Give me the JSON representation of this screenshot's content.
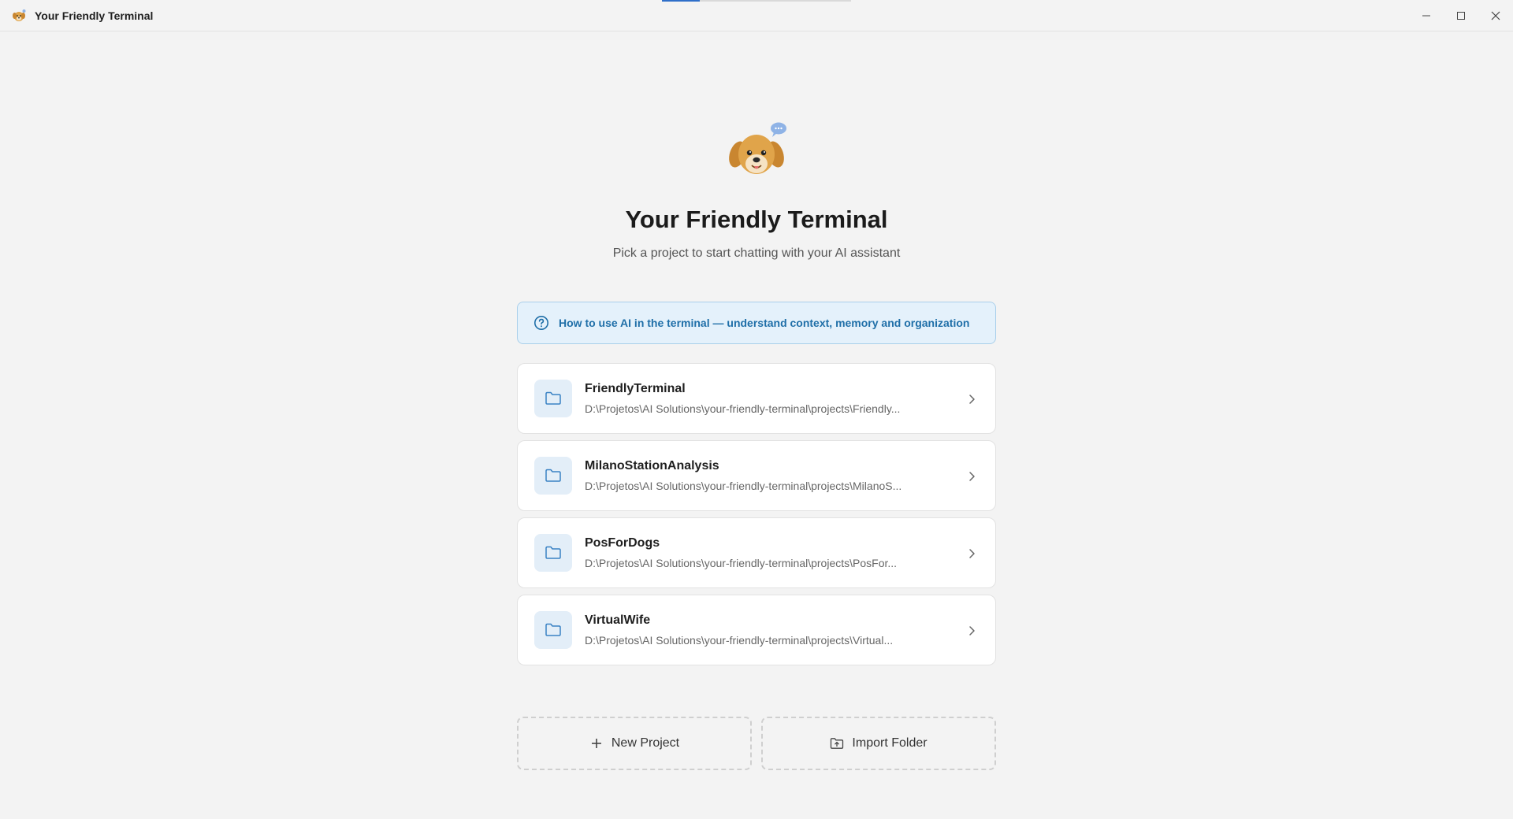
{
  "window": {
    "title": "Your Friendly Terminal",
    "icon": "dog-icon",
    "loading_progress": 0.2,
    "controls": {
      "minimize": "minimize-icon",
      "maximize": "maximize-icon",
      "close": "close-icon"
    }
  },
  "hero": {
    "logo": "dog-with-chat-bubble-icon",
    "title": "Your Friendly Terminal",
    "subtitle": "Pick a project to start chatting with your AI assistant"
  },
  "help_banner": {
    "icon": "question-circle-icon",
    "text": "How to use AI in the terminal — understand context, memory and organization"
  },
  "projects": [
    {
      "name": "FriendlyTerminal",
      "path": "D:\\Projetos\\AI Solutions\\your-friendly-terminal\\projects\\Friendly..."
    },
    {
      "name": "MilanoStationAnalysis",
      "path": "D:\\Projetos\\AI Solutions\\your-friendly-terminal\\projects\\MilanoS..."
    },
    {
      "name": "PosForDogs",
      "path": "D:\\Projetos\\AI Solutions\\your-friendly-terminal\\projects\\PosFor..."
    },
    {
      "name": "VirtualWife",
      "path": "D:\\Projetos\\AI Solutions\\your-friendly-terminal\\projects\\Virtual..."
    }
  ],
  "actions": {
    "new_project": {
      "label": "New Project",
      "icon": "plus-icon"
    },
    "import_folder": {
      "label": "Import Folder",
      "icon": "folder-import-icon"
    }
  },
  "colors": {
    "background": "#f3f3f3",
    "accent": "#1f6fa8",
    "banner_bg": "#e4f1fb",
    "folder_tile": "#e3eef8"
  }
}
